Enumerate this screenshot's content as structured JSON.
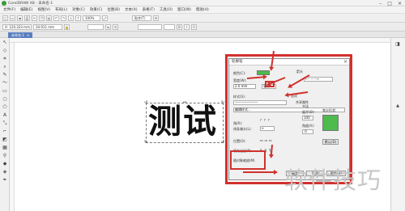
{
  "titlebar": {
    "title": "CorelDRAW X8 - 未命名-1"
  },
  "menu": {
    "items": [
      "文件(F)",
      "编辑(E)",
      "视图(V)",
      "布局(L)",
      "对象(C)",
      "效果(C)",
      "位图(B)",
      "文本(X)",
      "表格(T)",
      "工具(O)",
      "窗口(W)",
      "帮助(H)"
    ]
  },
  "toolbar": {
    "zoom": "100%",
    "snap": "贴齐(T)"
  },
  "propbar": {
    "x": "X: 120.333 mm",
    "y": "Y: 143.222 mm",
    "w": "34.911 mm",
    "h": "17.889 mm"
  },
  "tabs": {
    "doc": "未命名-1"
  },
  "canvas": {
    "text": "测试"
  },
  "dialog": {
    "title": "轮廓笔",
    "color_label": "颜色(C):",
    "width_label": "宽度(W):",
    "width_value": "2.0 mm",
    "unit_value": "毫米",
    "style_label": "样式(S):",
    "edit_style": "编辑样式...",
    "corner_label": "角(R):",
    "line_cap_label": "线条端头(L):",
    "position_label": "位置(O):",
    "arrows_label": "箭头",
    "options_label": "选项",
    "share_attr_label": "共享属性",
    "calligraphy_label": "书法",
    "stretch_label": "展开(D):",
    "stretch_value": "100",
    "angle_label": "角度(A):",
    "angle_value": ".0",
    "nib_label": "笔尖形状:",
    "default_btn": "默认(D)",
    "behind_fill": "填充之后(B)",
    "scale_with_image": "随对象缩放(M)",
    "ok_btn": "确定",
    "cancel_btn": "取消",
    "help_btn": "帮助(H)"
  },
  "colors": {
    "accent": "#d0312d",
    "nib": "#4dbb4d",
    "tab": "#5b7fbf"
  },
  "watermark": {
    "text": "软件技巧"
  }
}
